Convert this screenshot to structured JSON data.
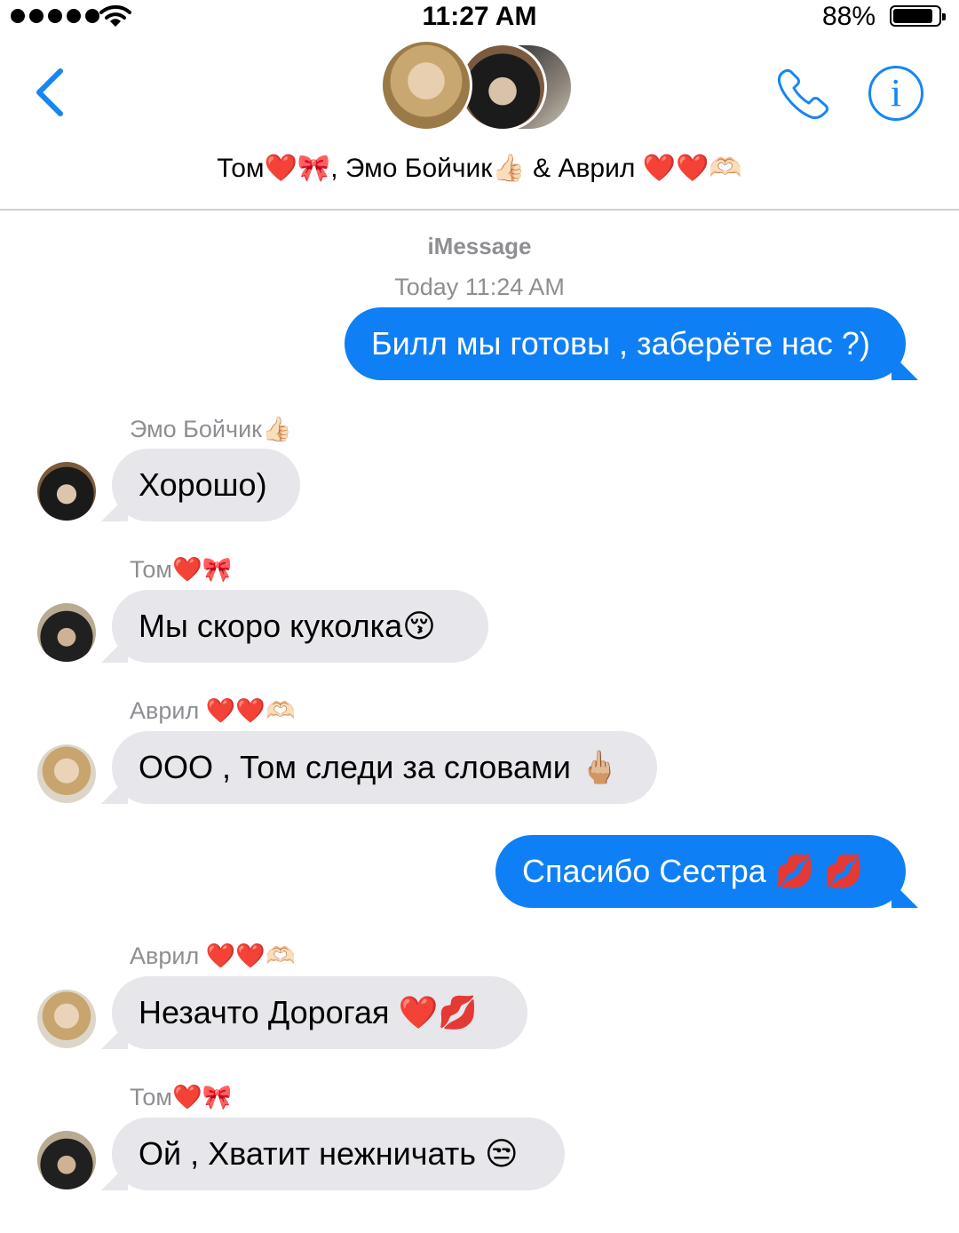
{
  "status_bar": {
    "time": "11:27 AM",
    "battery": "88%",
    "battery_level": 0.88
  },
  "header": {
    "title": "Том❤️🎀, Эмо Бойчик👍🏻 & Аврил ❤️❤️🫶🏻",
    "icons": {
      "back": "chevron-left-icon",
      "call": "phone-icon",
      "info": "info-icon"
    },
    "accent": "#1686f5"
  },
  "thread": {
    "service": "iMessage",
    "timestamp": "Today 11:24 AM",
    "messages": [
      {
        "direction": "outgoing",
        "text": "Билл мы готовы , заберёте нас ?)"
      },
      {
        "direction": "incoming",
        "sender": "Эмо Бойчик👍🏻",
        "text": "Хорошо)"
      },
      {
        "direction": "incoming",
        "sender": "Том❤️🎀",
        "text": "Мы скоро куколка😚"
      },
      {
        "direction": "incoming",
        "sender": "Аврил ❤️❤️🫶🏻",
        "text": "ООО , Том следи за словами 🖕🏼"
      },
      {
        "direction": "outgoing",
        "text": "Спасибо Сестра 💋 💋"
      },
      {
        "direction": "incoming",
        "sender": "Аврил ❤️❤️🫶🏻",
        "text": "Незачто Дорогая ❤️💋"
      },
      {
        "direction": "incoming",
        "sender": "Том❤️🎀",
        "text": "Ой , Хватит нежничать 😒"
      }
    ]
  },
  "colors": {
    "outgoing_bubble": "#0f7ff5",
    "incoming_bubble": "#e6e6eb",
    "meta_text": "#8e8e93"
  }
}
